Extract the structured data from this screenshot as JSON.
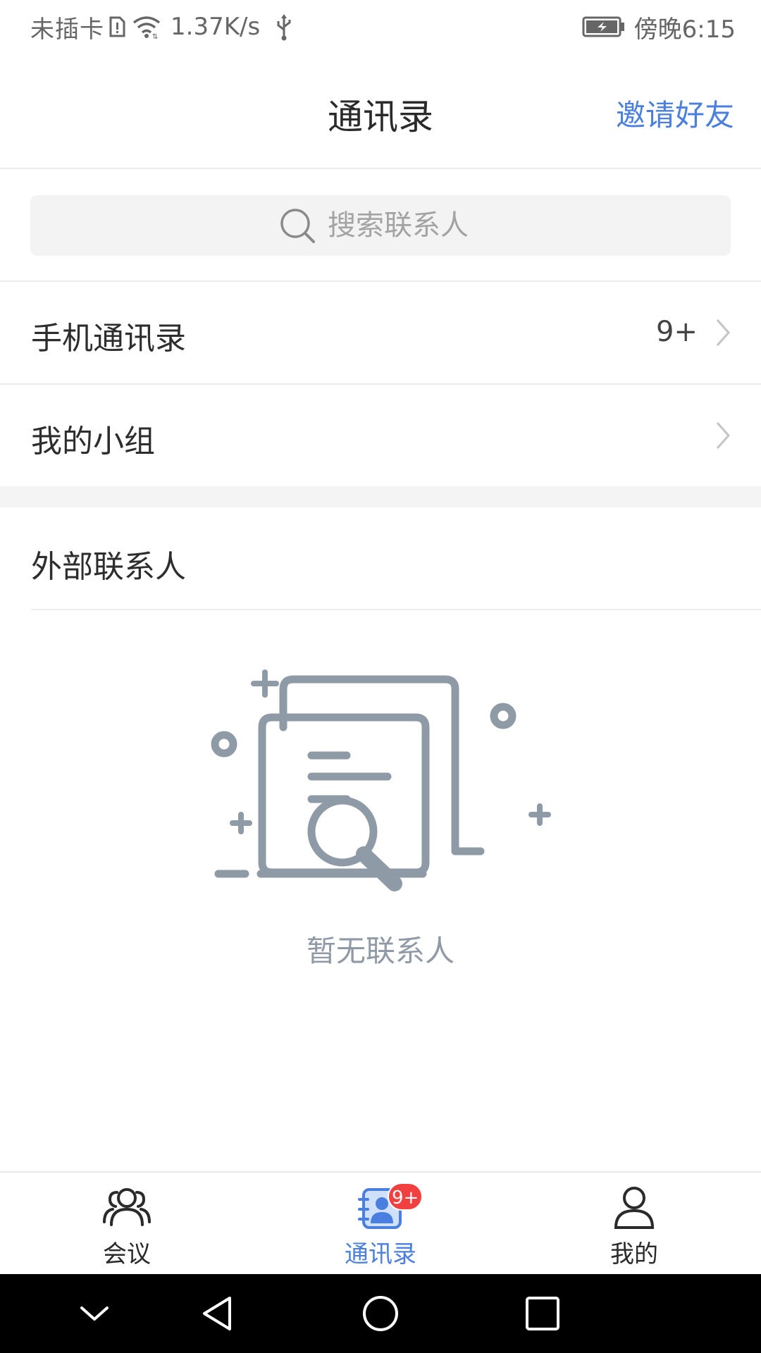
{
  "status_bar": {
    "carrier": "未插卡",
    "speed": "1.37K/s",
    "time": "傍晚6:15",
    "icons": [
      "sim-alert-icon",
      "wifi-icon",
      "usb-icon",
      "battery-charging-icon"
    ]
  },
  "header": {
    "title": "通讯录",
    "invite_label": "邀请好友"
  },
  "search": {
    "placeholder": "搜索联系人"
  },
  "list": {
    "phone_contacts": {
      "label": "手机通讯录",
      "count": "9+"
    },
    "my_groups": {
      "label": "我的小组"
    }
  },
  "external": {
    "title": "外部联系人",
    "empty_text": "暂无联系人"
  },
  "tabs": [
    {
      "label": "会议",
      "icon": "people-icon",
      "active": false
    },
    {
      "label": "通讯录",
      "icon": "contacts-book-icon",
      "active": true,
      "badge": "9+"
    },
    {
      "label": "我的",
      "icon": "person-icon",
      "active": false
    }
  ],
  "colors": {
    "accent": "#4a7fe0",
    "badge": "#f24040",
    "illustration": "#8f9aa7"
  }
}
